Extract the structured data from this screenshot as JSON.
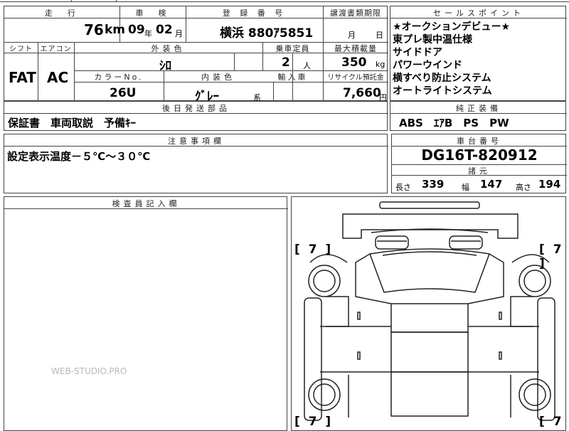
{
  "header": {
    "mileage_label": "走　行",
    "inspection_label": "車　検",
    "reg_label": "登 録 番 号",
    "transfer_label": "譲渡書類期限",
    "selling_points_label": "セールスポイント"
  },
  "row1": {
    "mileage_value": "76",
    "mileage_unit": "km",
    "inspection_year": "09",
    "inspection_year_unit": "年",
    "inspection_month": "02",
    "inspection_month_unit": "月",
    "registration": "横浜 880ｱ5851",
    "transfer_month": "月",
    "transfer_day": "日"
  },
  "row2_headers": {
    "shift": "シフト",
    "aircon": "エアコン",
    "exterior_color": "外装色",
    "capacity": "乗車定員",
    "max_load": "最大積載量"
  },
  "row2": {
    "shift": "FAT",
    "aircon": "AC",
    "color_name": "ｼﾛ",
    "capacity_value": "2",
    "capacity_unit": "人",
    "max_load_value": "350",
    "max_load_unit": "kg"
  },
  "row3_headers": {
    "color_no": "カラーNo.",
    "interior_color": "内装色",
    "import": "輸入車",
    "recycle": "リサイクル預託金"
  },
  "row3": {
    "color_no": "26U",
    "interior": "ｸﾞﾚｰ",
    "interior_suffix": "系",
    "recycle_value": "7,660",
    "recycle_unit": "円"
  },
  "selling_points": [
    "★オークションデビュー★",
    "東プレ製中温仕様",
    "サイドドア",
    "パワーウインド",
    "横すべり防止システム",
    "オートライトシステム"
  ],
  "accessories": {
    "label": "後日発送部品",
    "value": "保証書　車両取説　予備ｷｰ"
  },
  "equipment": {
    "label": "純正装備",
    "value": "ABS　ｴｱB　PS　PW"
  },
  "notes": {
    "label": "注意事項欄",
    "value": "設定表示温度－５℃～３０℃"
  },
  "chassis": {
    "label": "車台番号",
    "value": "DG16T-820912"
  },
  "specs": {
    "label": "諸元",
    "length_label": "長さ",
    "length_value": "339",
    "width_label": "幅",
    "width_value": "147",
    "height_label": "高さ",
    "height_value": "194"
  },
  "inspector": {
    "label": "検査員記入欄"
  },
  "diagram": {
    "tire_front_left": "[ 7 ]",
    "tire_front_right": "[ 7 ]",
    "tire_rear_left": "[ 7 ]",
    "tire_rear_right": "[ 7 ]"
  },
  "watermark": "WEB-STUDIO.PRO"
}
